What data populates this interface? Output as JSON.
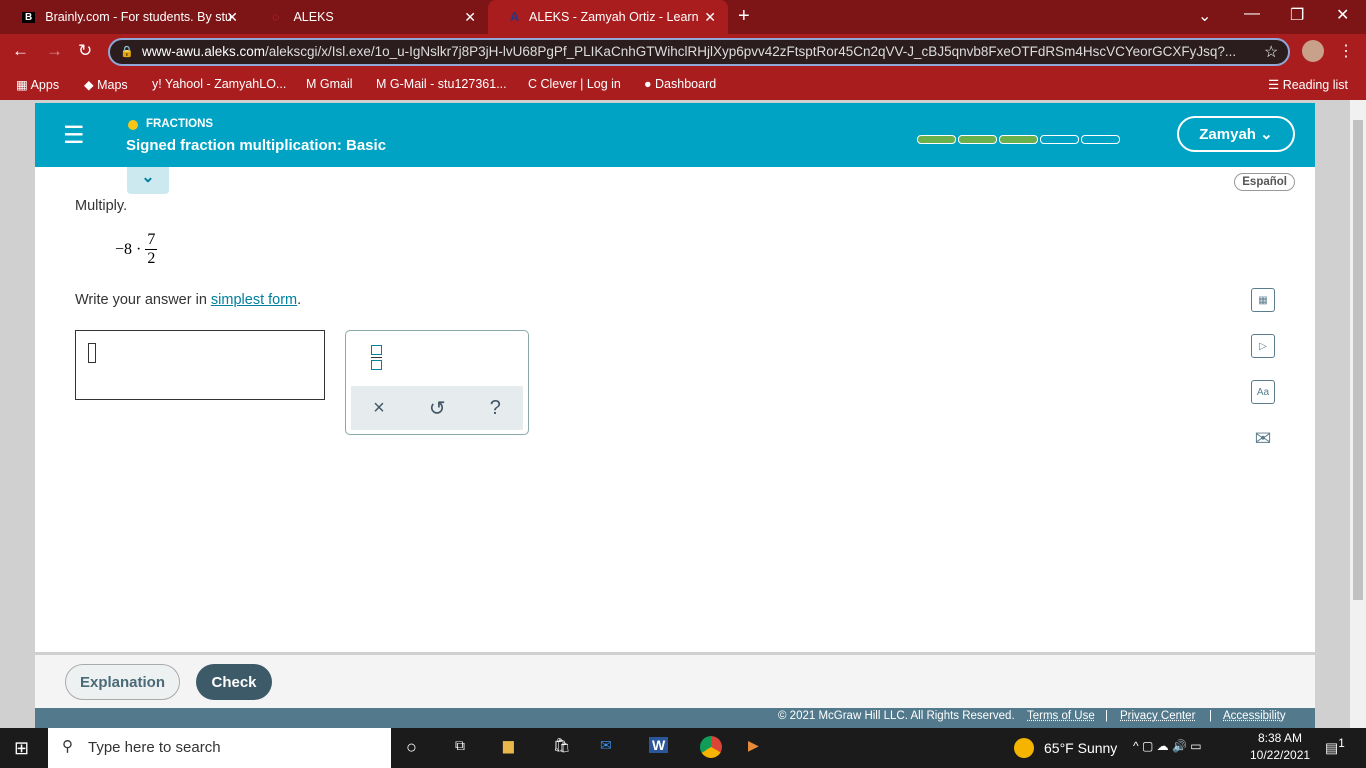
{
  "browser": {
    "tabs": [
      {
        "title": "Brainly.com - For students. By stu"
      },
      {
        "title": "ALEKS"
      },
      {
        "title": "ALEKS - Zamyah Ortiz - Learn",
        "active": true
      }
    ],
    "url_host": "www-awu.aleks.com",
    "url_path": "/alekscgi/x/Isl.exe/1o_u-IgNslkr7j8P3jH-lvU68PgPf_PLIKaCnhGTWihclRHjlXyp6pvv42zFtsptRor45Cn2qVV-J_cBJ5qnvb8FxeOTFdRSm4HscVCYeorGCXFyJsq?...",
    "bookmarks": [
      "Apps",
      "Maps",
      "Yahool - ZamyahLO...",
      "Gmail",
      "G-Mail -  stu127361...",
      "Clever | Log in",
      "Dashboard"
    ],
    "reading_list": "Reading list"
  },
  "header": {
    "topic": "FRACTIONS",
    "title": "Signed fraction multiplication: Basic",
    "user": "Zamyah",
    "progress_filled": 3,
    "progress_total": 5
  },
  "problem": {
    "espanol": "Español",
    "instruction": "Multiply.",
    "expr_prefix": "−8 ·",
    "numerator": "7",
    "denominator": "2",
    "write_prefix": "Write your answer in ",
    "link": "simplest form",
    "write_suffix": "."
  },
  "keypad": {
    "clear": "×",
    "undo": "↺",
    "help": "?"
  },
  "buttons": {
    "explanation": "Explanation",
    "check": "Check"
  },
  "footer": {
    "copyright": "© 2021 McGraw Hill LLC. All Rights Reserved.",
    "terms": "Terms of Use",
    "privacy": "Privacy Center",
    "accessibility": "Accessibility"
  },
  "taskbar": {
    "search": "Type here to search",
    "weather": "65°F  Sunny",
    "time": "8:38 AM",
    "date": "10/22/2021",
    "notifications": "1"
  }
}
